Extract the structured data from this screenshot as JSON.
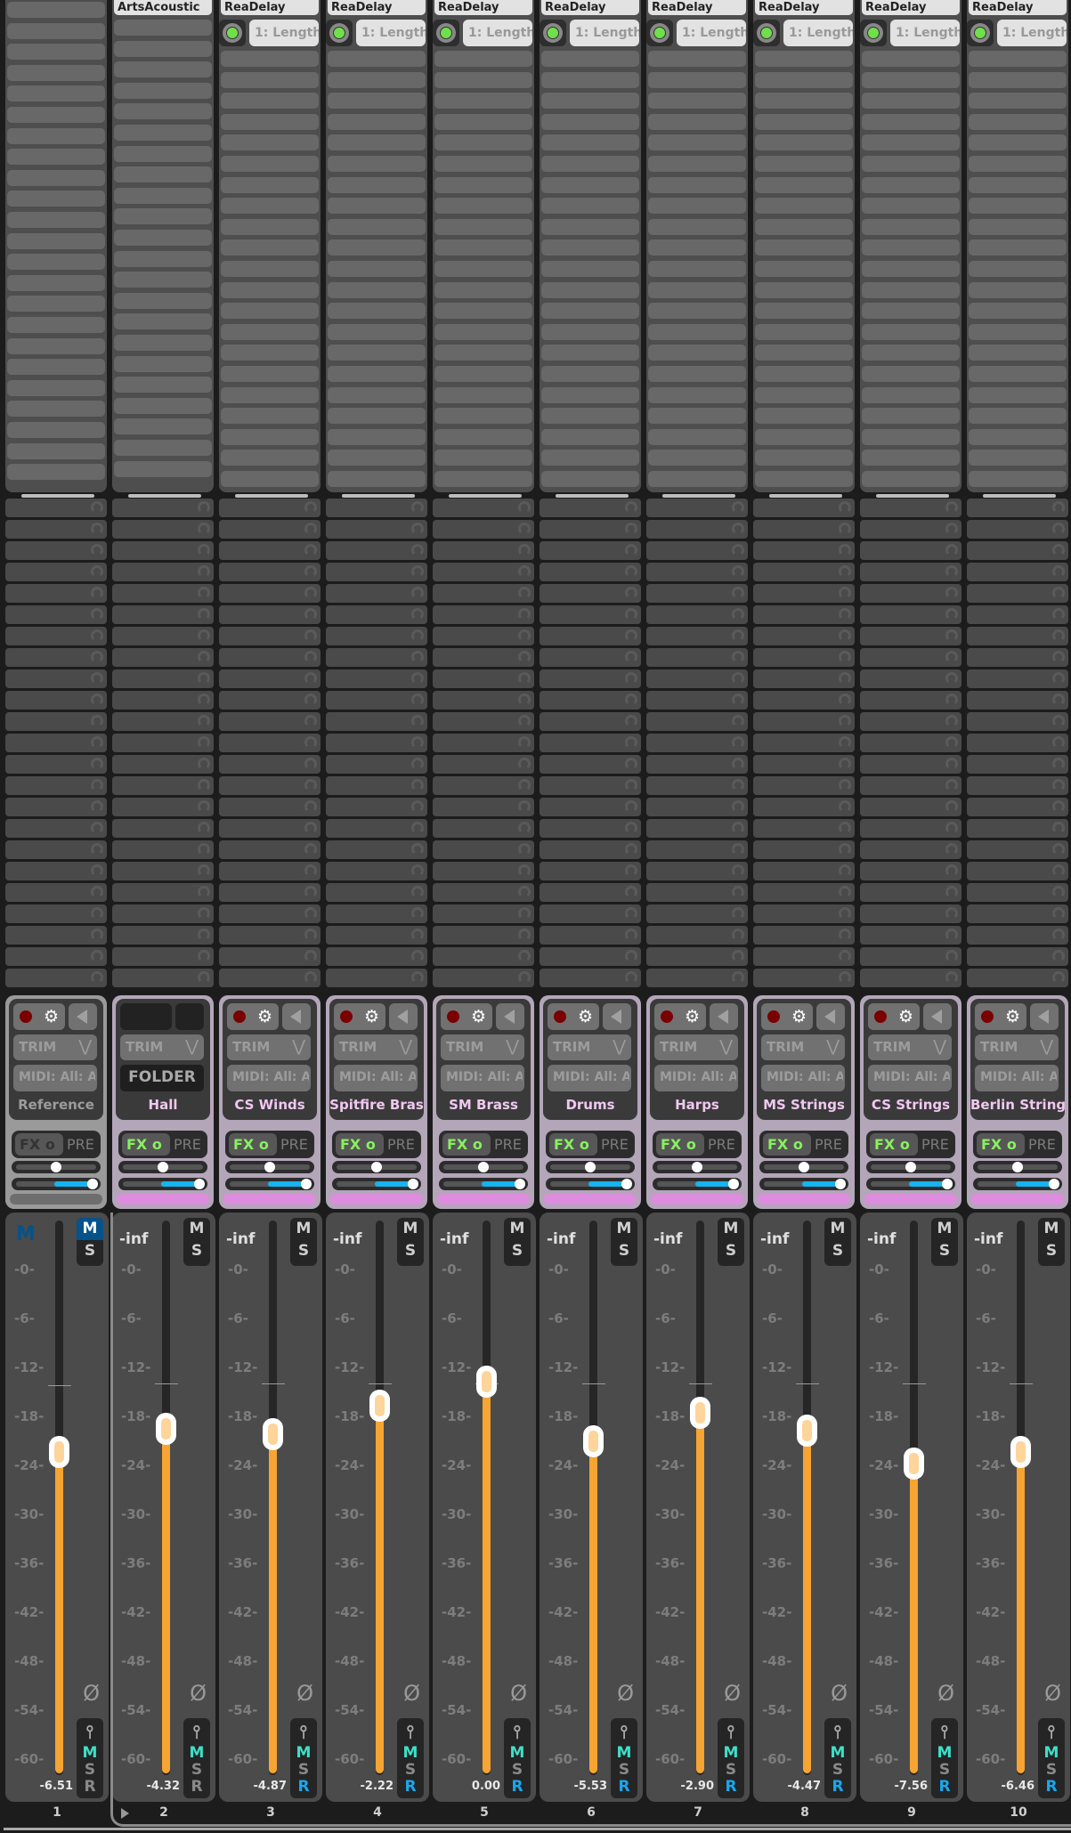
{
  "colors": {
    "folder_border": "#b3a6b9",
    "track_color": "#dd8ddd",
    "fader_fill": "#f7a432",
    "mute_active": "#06528a",
    "fx_on": "#88f060",
    "width_fill": "#16b4f0"
  },
  "fader_scale": [
    "-0-",
    "-6-",
    "-12-",
    "-18-",
    "-24-",
    "-30-",
    "-36-",
    "-42-",
    "-48-",
    "-54-",
    "-60-"
  ],
  "tracks": [
    {
      "number": "1",
      "name": "Reference",
      "fx_name": "",
      "fx_param": "",
      "volume": "-6.51",
      "volume_db": -6.51,
      "top_label": "M",
      "midi": "MIDI: All: Al",
      "trim": "TRIM",
      "fx": "FX",
      "pre": "PRE",
      "mute": "M",
      "solo": "S",
      "rec": "R",
      "is_folder": false,
      "reference": true,
      "rec_armed_blue": false
    },
    {
      "number": "2",
      "name": "Hall",
      "fx_name": "ArtsAcoustic",
      "fx_param": "",
      "volume": "-4.32",
      "volume_db": -4.32,
      "top_label": "-inf",
      "midi": "FOLDER",
      "trim": "TRIM",
      "fx": "FX",
      "pre": "PRE",
      "mute": "M",
      "solo": "S",
      "rec": "R",
      "is_folder": true,
      "reference": false,
      "rec_armed_blue": false
    },
    {
      "number": "3",
      "name": "CS Winds",
      "fx_name": "ReaDelay",
      "fx_param": "1: Length",
      "volume": "-4.87",
      "volume_db": -4.87,
      "top_label": "-inf",
      "midi": "MIDI: All: Al",
      "trim": "TRIM",
      "fx": "FX",
      "pre": "PRE",
      "mute": "M",
      "solo": "S",
      "rec": "R",
      "is_folder": false,
      "reference": false,
      "rec_armed_blue": true
    },
    {
      "number": "4",
      "name": "Spitfire Bras",
      "fx_name": "ReaDelay",
      "fx_param": "1: Length",
      "volume": "-2.22",
      "volume_db": -2.22,
      "top_label": "-inf",
      "midi": "MIDI: All: Al",
      "trim": "TRIM",
      "fx": "FX",
      "pre": "PRE",
      "mute": "M",
      "solo": "S",
      "rec": "R",
      "is_folder": false,
      "reference": false,
      "rec_armed_blue": true
    },
    {
      "number": "5",
      "name": "SM Brass",
      "fx_name": "ReaDelay",
      "fx_param": "1: Length",
      "volume": "0.00",
      "volume_db": 0,
      "top_label": "-inf",
      "midi": "MIDI: All: Al",
      "trim": "TRIM",
      "fx": "FX",
      "pre": "PRE",
      "mute": "M",
      "solo": "S",
      "rec": "R",
      "is_folder": false,
      "reference": false,
      "rec_armed_blue": true
    },
    {
      "number": "6",
      "name": "Drums",
      "fx_name": "ReaDelay",
      "fx_param": "1: Length",
      "volume": "-5.53",
      "volume_db": -5.53,
      "top_label": "-inf",
      "midi": "MIDI: All: Al",
      "trim": "TRIM",
      "fx": "FX",
      "pre": "PRE",
      "mute": "M",
      "solo": "S",
      "rec": "R",
      "is_folder": false,
      "reference": false,
      "rec_armed_blue": true
    },
    {
      "number": "7",
      "name": "Harps",
      "fx_name": "ReaDelay",
      "fx_param": "1: Length",
      "volume": "-2.90",
      "volume_db": -2.9,
      "top_label": "-inf",
      "midi": "MIDI: All: Al",
      "trim": "TRIM",
      "fx": "FX",
      "pre": "PRE",
      "mute": "M",
      "solo": "S",
      "rec": "R",
      "is_folder": false,
      "reference": false,
      "rec_armed_blue": true
    },
    {
      "number": "8",
      "name": "MS Strings",
      "fx_name": "ReaDelay",
      "fx_param": "1: Length",
      "volume": "-4.47",
      "volume_db": -4.47,
      "top_label": "-inf",
      "midi": "MIDI: All: Al",
      "trim": "TRIM",
      "fx": "FX",
      "pre": "PRE",
      "mute": "M",
      "solo": "S",
      "rec": "R",
      "is_folder": false,
      "reference": false,
      "rec_armed_blue": true
    },
    {
      "number": "9",
      "name": "CS Strings",
      "fx_name": "ReaDelay",
      "fx_param": "1: Length",
      "volume": "-7.56",
      "volume_db": -7.56,
      "top_label": "-inf",
      "midi": "MIDI: All: Al",
      "trim": "TRIM",
      "fx": "FX",
      "pre": "PRE",
      "mute": "M",
      "solo": "S",
      "rec": "R",
      "is_folder": false,
      "reference": false,
      "rec_armed_blue": true
    },
    {
      "number": "10",
      "name": "Berlin String",
      "fx_name": "ReaDelay",
      "fx_param": "1: Length",
      "volume": "-6.46",
      "volume_db": -6.46,
      "top_label": "-inf",
      "midi": "MIDI: All: Al",
      "trim": "TRIM",
      "fx": "FX",
      "pre": "PRE",
      "mute": "M",
      "solo": "S",
      "rec": "R",
      "is_folder": false,
      "reference": false,
      "rec_armed_blue": true
    }
  ]
}
